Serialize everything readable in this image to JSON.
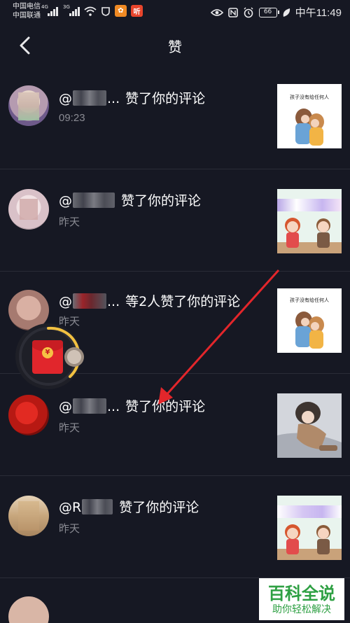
{
  "status_bar": {
    "carrier_1": "中国电信",
    "carrier_2": "中国联通",
    "net_1": "4G",
    "net_2": "3G",
    "app_badge_2": "听",
    "battery": "66",
    "time": "中午11:49"
  },
  "header": {
    "title": "赞",
    "back_icon": "chevron-left-icon"
  },
  "notifications": [
    {
      "name_prefix": "@",
      "name_suffix": "...",
      "action": "赞了你的评论",
      "time": "09:23",
      "thumb_caption": "孩子没有给任何人"
    },
    {
      "name_prefix": "@",
      "name_suffix": "",
      "action": "赞了你的评论",
      "time": "昨天",
      "thumb_caption": ""
    },
    {
      "name_prefix": "@",
      "name_suffix": "...",
      "action": "等2人赞了你的评论",
      "time": "昨天",
      "thumb_caption": "孩子没有给任何人"
    },
    {
      "name_prefix": "@",
      "name_suffix": "...",
      "action": "赞了你的评论",
      "time": "昨天",
      "thumb_caption": ""
    },
    {
      "name_prefix": "@R",
      "name_suffix": "",
      "action": "赞了你的评论",
      "time": "昨天",
      "thumb_caption": ""
    }
  ],
  "red_packet": {
    "symbol": "¥"
  },
  "watermark": {
    "main": "百科全说",
    "sub": "助你轻松解决"
  },
  "colors": {
    "background": "#161823",
    "divider": "#2a2c37",
    "time_text": "#8a8b93",
    "arrow": "#e3262b",
    "ring": "#f2c141",
    "watermark_green": "#2ea043"
  }
}
